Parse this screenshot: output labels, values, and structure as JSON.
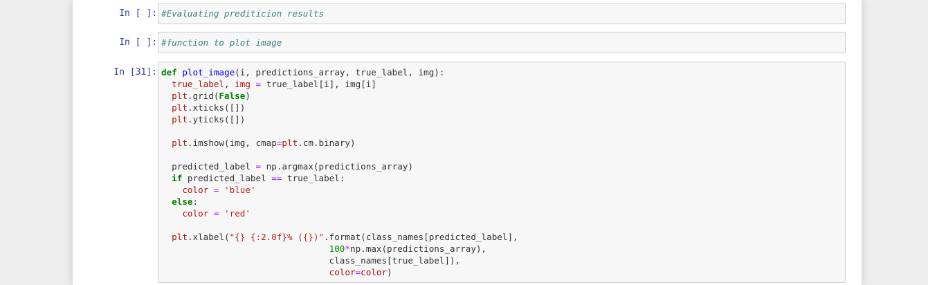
{
  "cells": [
    {
      "prompt": "In [ ]:",
      "code": "#Evaluating prediticion results"
    },
    {
      "prompt": "In [ ]:",
      "code": "#function to plot image"
    },
    {
      "prompt": "In [31]:",
      "lines": [
        "def plot_image(i, predictions_array, true_label, img):",
        "  true_label, img = true_label[i], img[i]",
        "  plt.grid(False)",
        "  plt.xticks([])",
        "  plt.yticks([])",
        "",
        "  plt.imshow(img, cmap=plt.cm.binary)",
        "",
        "  predicted_label = np.argmax(predictions_array)",
        "  if predicted_label == true_label:",
        "    color = 'blue'",
        "  else:",
        "    color = 'red'",
        "",
        "  plt.xlabel(\"{} {:2.0f}% ({})\".format(class_names[predicted_label],",
        "                                100*np.max(predictions_array),",
        "                                class_names[true_label]),",
        "                                color=color)"
      ]
    }
  ],
  "colors": {
    "prompt": "#303f9f",
    "comment": "#408080",
    "keyword": "#008000",
    "string": "#ba2121",
    "operator": "#aa22ff",
    "number": "#008800",
    "cell_background": "#f7f7f7"
  }
}
